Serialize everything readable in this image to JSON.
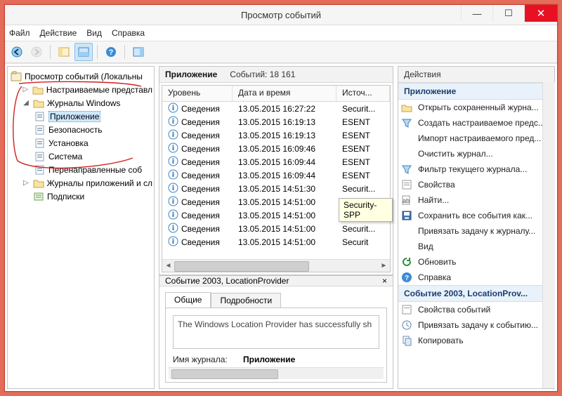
{
  "window": {
    "title": "Просмотр событий"
  },
  "menu": {
    "file": "Файл",
    "action": "Действие",
    "view": "Вид",
    "help": "Справка"
  },
  "tree": {
    "root": "Просмотр событий (Локальны",
    "custom": "Настраиваемые представл",
    "winlogs": "Журналы Windows",
    "app": "Приложение",
    "security": "Безопасность",
    "setup": "Установка",
    "system": "Система",
    "forwarded": "Перенаправленные соб",
    "appsvclogs": "Журналы приложений и сл",
    "subs": "Подписки"
  },
  "list": {
    "title": "Приложение",
    "count_label": "Событий: 18 161",
    "cols": {
      "level": "Уровень",
      "datetime": "Дата и время",
      "source": "Источ..."
    },
    "level_info": "Сведения",
    "rows": [
      {
        "dt": "13.05.2015 16:27:22",
        "src": "Securit..."
      },
      {
        "dt": "13.05.2015 16:19:13",
        "src": "ESENT"
      },
      {
        "dt": "13.05.2015 16:19:13",
        "src": "ESENT"
      },
      {
        "dt": "13.05.2015 16:09:46",
        "src": "ESENT"
      },
      {
        "dt": "13.05.2015 16:09:44",
        "src": "ESENT"
      },
      {
        "dt": "13.05.2015 16:09:44",
        "src": "ESENT"
      },
      {
        "dt": "13.05.2015 14:51:30",
        "src": "Securit..."
      },
      {
        "dt": "13.05.2015 14:51:00",
        "src": "Securi"
      },
      {
        "dt": "13.05.2015 14:51:00",
        "src": "Secur"
      },
      {
        "dt": "13.05.2015 14:51:00",
        "src": "Securit..."
      },
      {
        "dt": "13.05.2015 14:51:00",
        "src": "Securit"
      }
    ]
  },
  "detail": {
    "header": "Событие 2003, LocationProvider",
    "tab_general": "Общие",
    "tab_details": "Подробности",
    "message": "The Windows Location Provider has successfully sh",
    "log_label": "Имя журнала:",
    "log_value": "Приложение"
  },
  "actions": {
    "pane_title": "Действия",
    "group1": "Приложение",
    "open": "Открыть сохраненный журна...",
    "create": "Создать настраиваемое предс...",
    "import": "Импорт настраиваемого пред...",
    "clear": "Очистить журнал...",
    "filter": "Фильтр текущего журнала...",
    "props": "Свойства",
    "find": "Найти...",
    "save": "Сохранить все события как...",
    "attach": "Привязать задачу к журналу...",
    "view": "Вид",
    "refresh": "Обновить",
    "help": "Справка",
    "group2": "Событие 2003, LocationProv...",
    "evprops": "Свойства событий",
    "evattach": "Привязать задачу к событию...",
    "copy": "Копировать"
  },
  "tooltip": "Security-SPP"
}
